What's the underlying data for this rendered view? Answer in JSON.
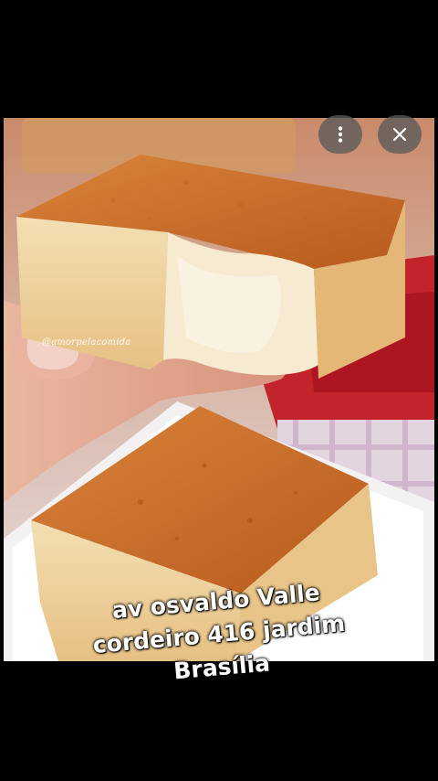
{
  "photo": {
    "watermark_text": "@amorpelacomida",
    "subject": "cake-squares-photo"
  },
  "controls": {
    "more_icon": "more-vert-icon",
    "close_icon": "close-icon",
    "button_color": "#5a5a5a"
  },
  "caption": {
    "lines": [
      "av osvaldo Valle",
      "cordeiro 416 jardim",
      "Brasília"
    ]
  }
}
